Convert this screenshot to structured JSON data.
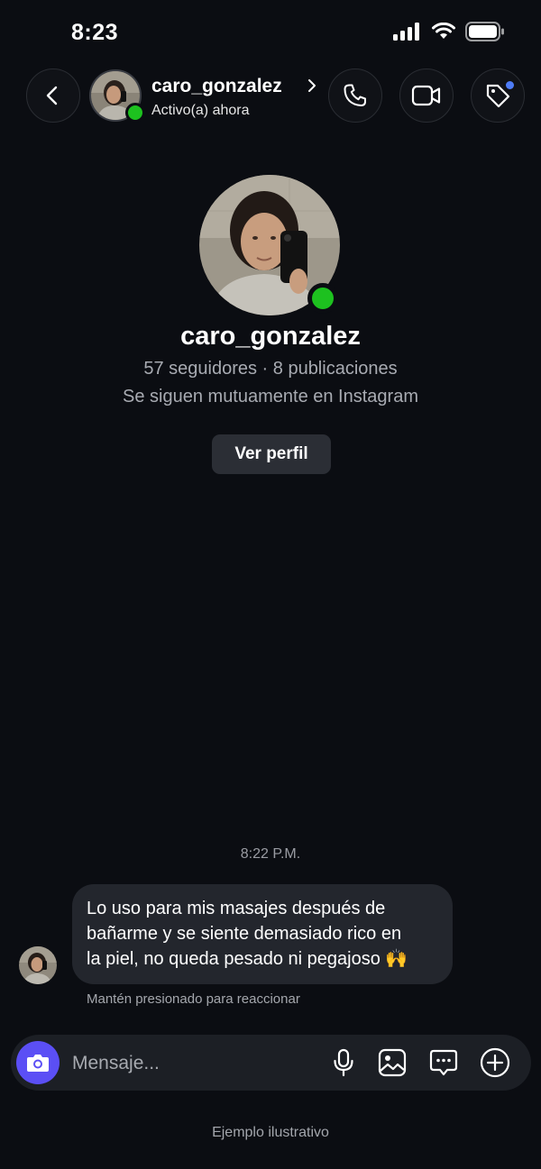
{
  "status_bar": {
    "time": "8:23"
  },
  "header": {
    "username": "caro_gonzalez",
    "activity": "Activo(a) ahora"
  },
  "profile": {
    "username": "caro_gonzalez",
    "stats": "57 seguidores · 8 publicaciones",
    "mutual": "Se siguen mutuamente en Instagram",
    "view_button": "Ver perfil"
  },
  "conversation": {
    "timestamp": "8:22 P.M.",
    "message_lines": [
      "Lo uso para mis masajes después de",
      "bañarme y se siente demasiado rico en",
      "la piel, no queda pesado ni pegajoso 🙌"
    ],
    "reaction_hint": "Mantén presionado para reaccionar"
  },
  "composer": {
    "placeholder": "Mensaje..."
  },
  "footer": {
    "note": "Ejemplo ilustrativo"
  },
  "colors": {
    "background": "#0b0d12",
    "online": "#1dc11f",
    "accent_camera": "#5b4ff5",
    "notification_dot": "#4e7cf6",
    "bubble": "#23262d"
  }
}
